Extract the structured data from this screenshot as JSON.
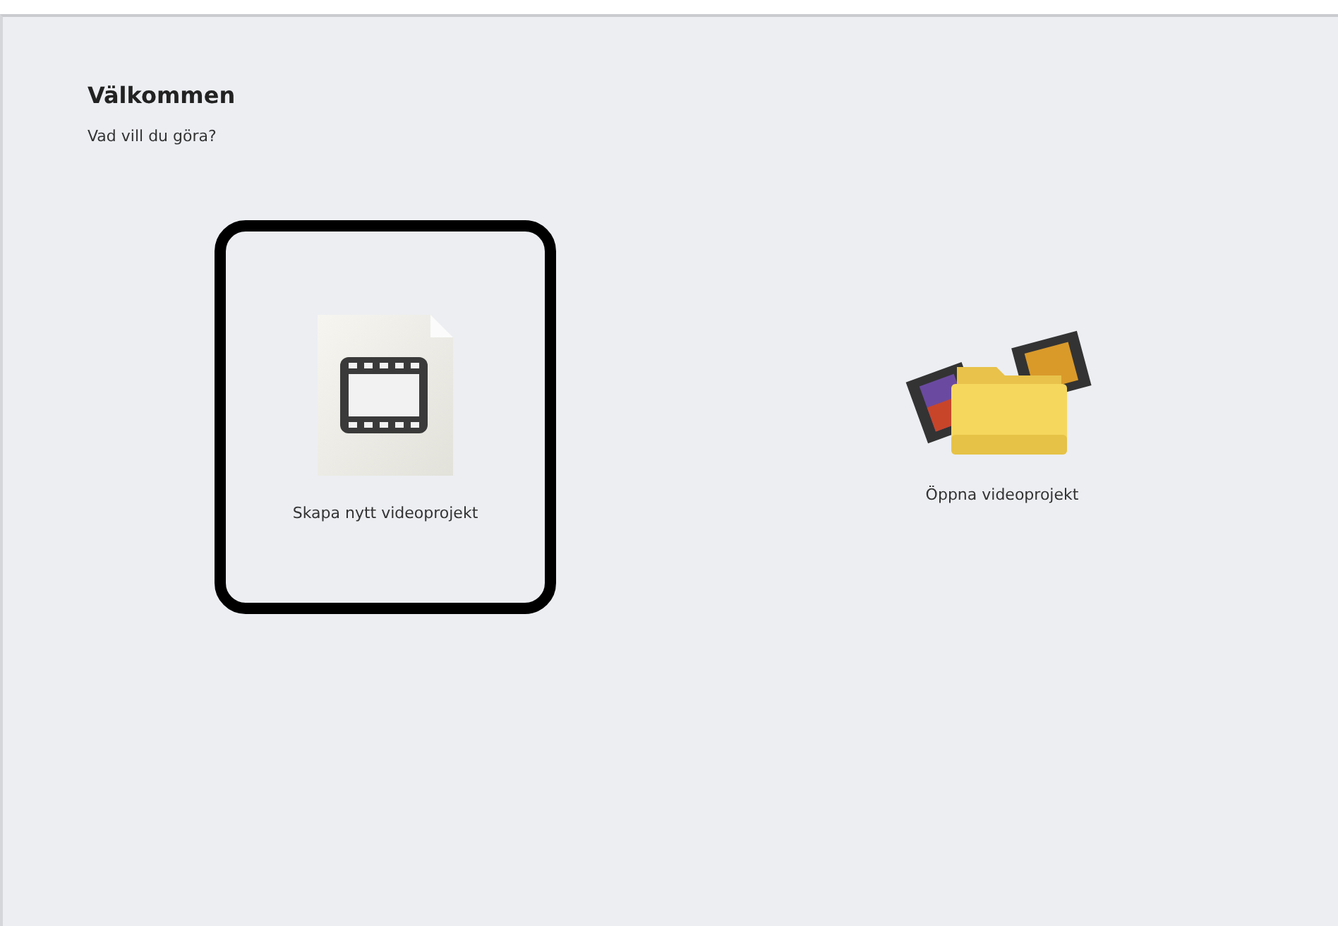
{
  "heading": "Välkommen",
  "prompt": "Vad vill du göra?",
  "options": [
    {
      "kind": "new",
      "label": "Skapa nytt videoprojekt",
      "selected": true
    },
    {
      "kind": "open",
      "label": "Öppna videoprojekt",
      "selected": false
    }
  ]
}
